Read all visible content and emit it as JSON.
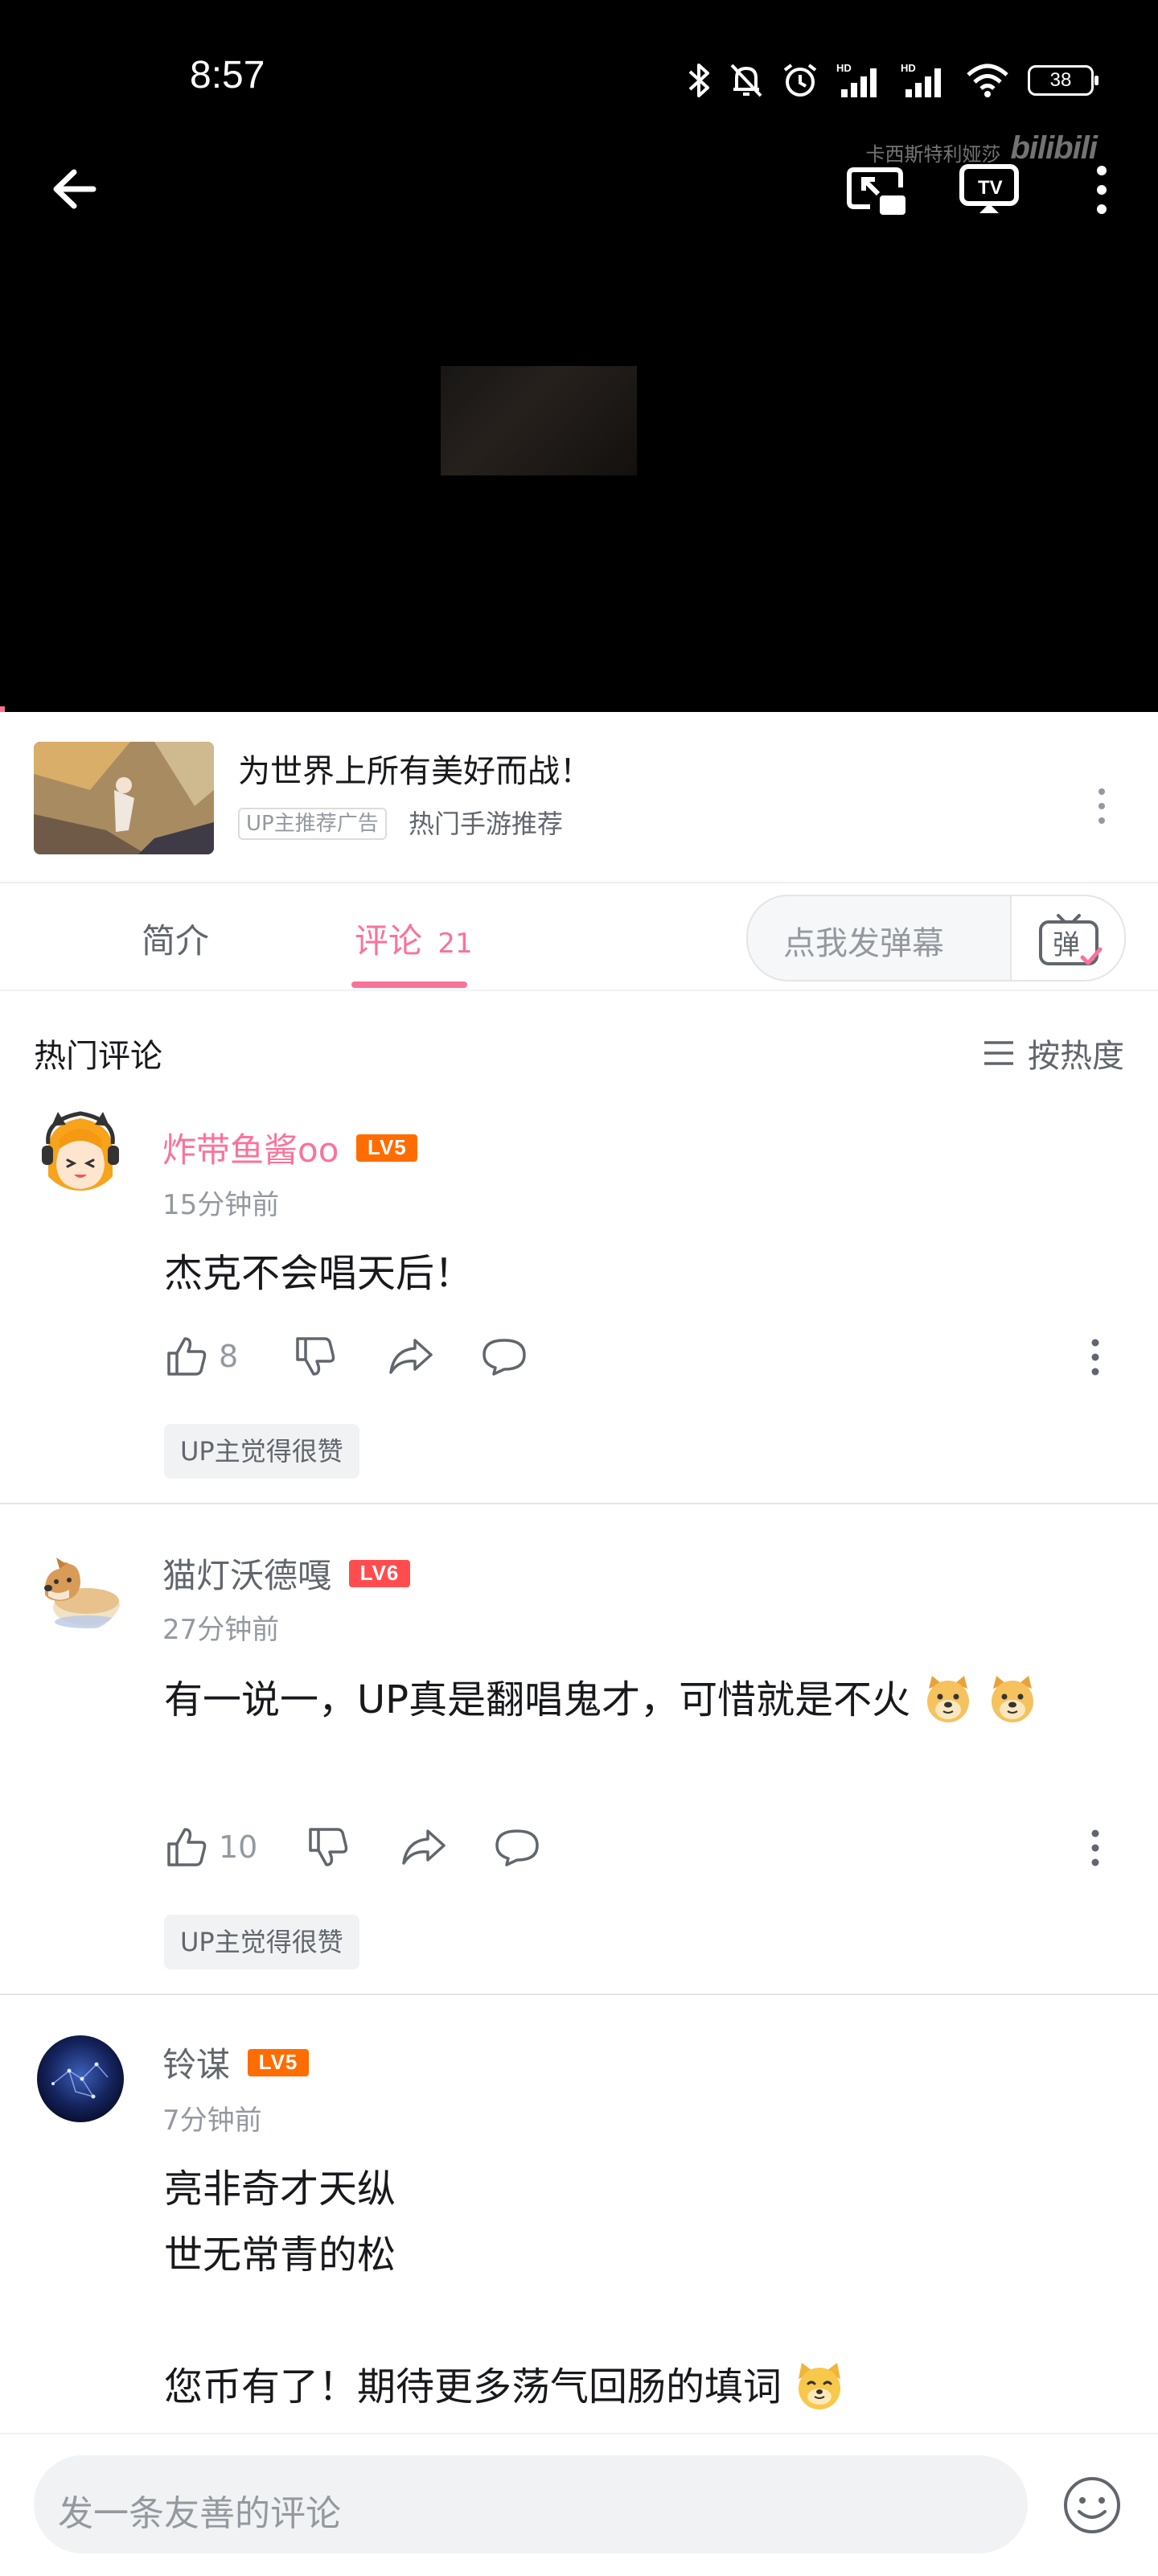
{
  "status_bar": {
    "time": "8:57",
    "battery": "38",
    "signal_label": "HD"
  },
  "player": {
    "watermark_channel": "卡西斯特利娅莎",
    "watermark_brand": "bilibili"
  },
  "ad": {
    "title": "为世界上所有美好而战！",
    "tag": "UP主推荐广告",
    "subtitle": "热门手游推荐"
  },
  "tabs": {
    "intro": "简介",
    "comments": "评论",
    "comments_count": "21",
    "danmu_placeholder": "点我发弹幕",
    "danmu_btn": "弹"
  },
  "comments_header": {
    "title": "热门评论",
    "sort": "按热度"
  },
  "comments": [
    {
      "user": "炸带鱼酱oo",
      "level": "LV5",
      "time": "15分钟前",
      "text": "杰克不会唱天后！",
      "likes": "8",
      "tag": "UP主觉得很赞",
      "name_color": "#fb7299",
      "level_color": "#ff6c00"
    },
    {
      "user": "猫灯沃德嘎",
      "level": "LV6",
      "time": "27分钟前",
      "text": "有一说一，UP真是翻唱鬼才，可惜就是不火",
      "likes": "10",
      "tag": "UP主觉得很赞",
      "name_color": "#61666d",
      "level_color": "#ff4d4f",
      "emoji": "doge-emoji"
    },
    {
      "user": "铃谋",
      "level": "LV5",
      "time": "7分钟前",
      "lines": [
        "亮非奇才天纵",
        "世无常青的松",
        "",
        "您币有了！期待更多荡气回肠的填词"
      ],
      "name_color": "#61666d",
      "level_color": "#ff6c00",
      "emoji": "cat-emoji"
    }
  ],
  "bottom_bar": {
    "placeholder": "发一条友善的评论"
  },
  "colors": {
    "accent": "#fb7299",
    "text_secondary": "#9499a0"
  }
}
